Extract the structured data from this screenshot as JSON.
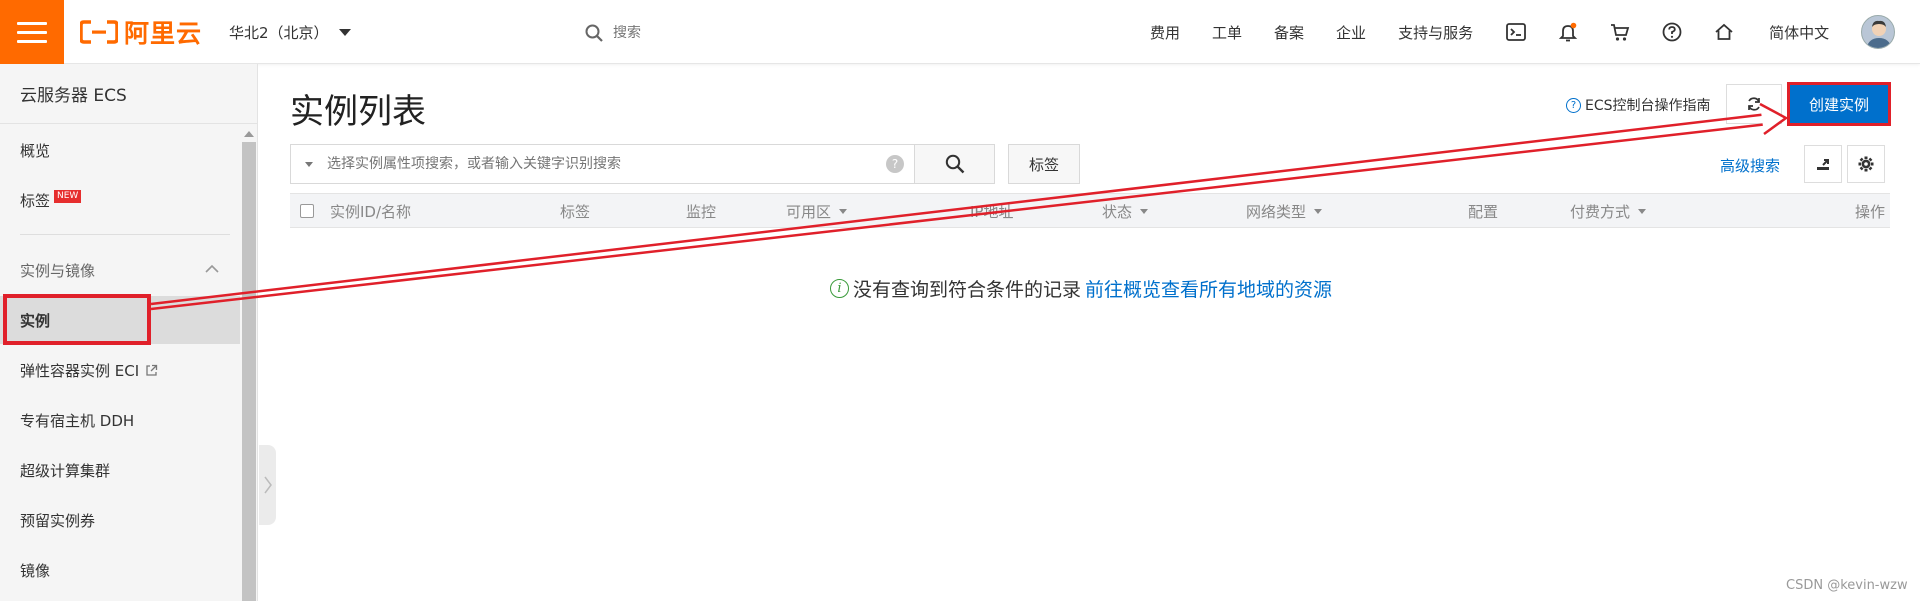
{
  "header": {
    "logo_text": "阿里云",
    "region": "华北2（北京）",
    "search_placeholder": "搜索",
    "nav": [
      "费用",
      "工单",
      "备案",
      "企业",
      "支持与服务"
    ],
    "icons": [
      "terminal-icon",
      "bell-icon",
      "cart-icon",
      "help-icon",
      "home-icon"
    ],
    "notification_dot_color": "#ff6a00",
    "language": "简体中文"
  },
  "sidebar": {
    "title": "云服务器 ECS",
    "items": {
      "overview": "概览",
      "tags": "标签",
      "tags_badge": "NEW",
      "group": "实例与镜像",
      "instance": "实例",
      "eci": "弹性容器实例 ECI",
      "ddh": "专有宿主机 DDH",
      "cluster": "超级计算集群",
      "reserved": "预留实例券",
      "image": "镜像"
    }
  },
  "main": {
    "title": "实例列表",
    "guide_link": "ECS控制台操作指南",
    "create_button": "创建实例",
    "filter_placeholder": "选择实例属性项搜索，或者输入关键字识别搜索",
    "tag_button": "标签",
    "advanced_search": "高级搜索",
    "columns": [
      "实例ID/名称",
      "标签",
      "监控",
      "可用区",
      "IP地址",
      "状态",
      "网络类型",
      "配置",
      "付费方式",
      "操作"
    ],
    "empty_text": "没有查询到符合条件的记录",
    "empty_link": "前往概览查看所有地域的资源"
  },
  "watermark": "CSDN @kevin-wzw",
  "colors": {
    "brand": "#ff6a00",
    "primary": "#0070cc",
    "annotation": "#e0202a"
  }
}
